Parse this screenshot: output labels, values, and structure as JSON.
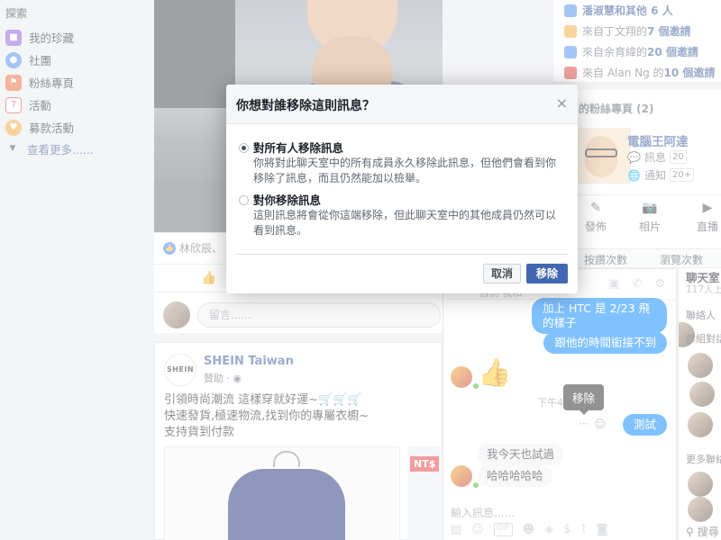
{
  "left_nav": {
    "heading": "探索",
    "items": [
      {
        "label": "我的珍藏",
        "icon": "bookmark-icon",
        "color": "#8b5ad6"
      },
      {
        "label": "社團",
        "icon": "groups-icon",
        "color": "#4a8ae8"
      },
      {
        "label": "粉絲專頁",
        "icon": "flag-icon",
        "color": "#e8663a"
      },
      {
        "label": "活動",
        "icon": "calendar-icon",
        "color": "#e04040"
      },
      {
        "label": "募款活動",
        "icon": "fundraiser-icon",
        "color": "#f0a93a"
      }
    ],
    "more_label": "查看更多......"
  },
  "post": {
    "reaction_names": "林欣辰、",
    "comment_placeholder": "留言......"
  },
  "ad": {
    "logo_text": "SHEIN",
    "name": "SHEIN Taiwan",
    "sponsored": "贊助",
    "line1": "引領時尚潮流 這樣穿就好運~🛒🛒🛒",
    "line2": "快速發貨,極速物流,找到你的專屬衣櫥~",
    "line3": "支持貨到付款",
    "price_tag": "NT$"
  },
  "right_col": {
    "invites": [
      {
        "prefix": "",
        "name": "潘淑慧和其他 6 人",
        "suffix": "",
        "color": "#4a8ae8"
      },
      {
        "prefix": "來自丁文翔的 ",
        "name": "7 個邀請",
        "suffix": "",
        "color": "#f0a93a"
      },
      {
        "prefix": "來自余育緯的 ",
        "name": "20 個邀請",
        "suffix": "",
        "color": "#4a8ae8"
      },
      {
        "prefix": "來自 Alan Ng 的 ",
        "name": "10 個邀請",
        "suffix": "",
        "color": "#e04040"
      }
    ],
    "pages_title": "的粉絲專頁 (2)",
    "page_name": "電腦王阿達",
    "page_stats": [
      {
        "label": "訊息",
        "count": "20"
      },
      {
        "label": "通知",
        "count": "20+"
      }
    ],
    "page_actions": [
      "發佈",
      "相片",
      "直播"
    ],
    "tabs": [
      "按讚次數",
      "瀏覽次數"
    ]
  },
  "chat": {
    "header_label": "目前 我和",
    "messages_me": [
      "加上 HTC 是 2/23 飛的樣子",
      "跟他的時間銜接不到"
    ],
    "time_label": "下午4",
    "tooltip": "移除",
    "test_message": "測試",
    "messages_other": [
      "我今天也試過",
      "哈哈哈哈哈"
    ],
    "input_placeholder": "輸入訊息......"
  },
  "chat_sidebar": {
    "title": "聊天室",
    "subtitle": "117人上",
    "contacts_label": "聯絡人",
    "group_label": "群組對話",
    "more_label": "更多聯絡",
    "search_label": "搜尋"
  },
  "dialog": {
    "title": "你想對誰移除這則訊息？",
    "close": "×",
    "option1_title": "對所有人移除訊息",
    "option1_desc": "你將對此聊天室中的所有成員永久移除此訊息，但他們會看到你移除了訊息，而且仍然能加以檢舉。",
    "option2_title": "對你移除訊息",
    "option2_desc": "這則訊息將會從你這端移除，但此聊天室中的其他成員仍然可以看到訊息。",
    "cancel_label": "取消",
    "remove_label": "移除",
    "selected_option": 1
  }
}
